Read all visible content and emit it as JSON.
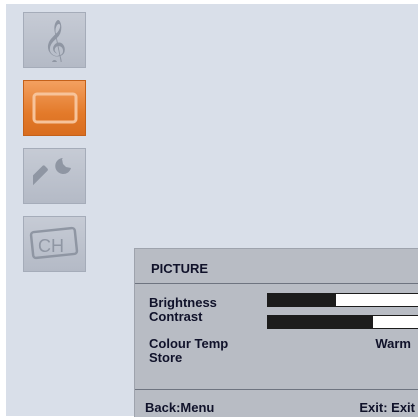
{
  "side_menu": {
    "items": [
      {
        "name": "sound",
        "icon": "music-note-icon",
        "active": false
      },
      {
        "name": "picture",
        "icon": "tv-screen-icon",
        "active": true
      },
      {
        "name": "setup",
        "icon": "wrench-icon",
        "active": false
      },
      {
        "name": "channel",
        "icon": "channel-icon",
        "active": false,
        "icon_text": "CH"
      }
    ]
  },
  "osd": {
    "title": "PICTURE",
    "items": [
      {
        "label": "Brightness",
        "level_percent": 45
      },
      {
        "label": "Contrast",
        "level_percent": 70
      },
      {
        "label": "Colour Temp",
        "value": "Warm"
      },
      {
        "label": "Store"
      }
    ],
    "footer": {
      "back_hint": "Back:Menu",
      "exit_hint": "Exit: Exit"
    }
  },
  "colors": {
    "screen_bg": "#d9dfe9",
    "active_tile": "#e37a2a",
    "panel_bg": "#b8bcc4",
    "text": "#10122a"
  }
}
